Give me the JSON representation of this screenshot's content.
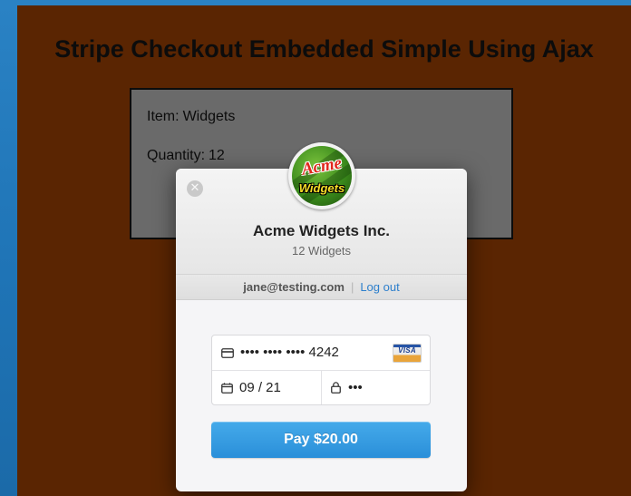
{
  "page": {
    "title": "Stripe Checkout Embedded Simple Using Ajax"
  },
  "order": {
    "item_label": "Item:",
    "item_value": "Widgets",
    "quantity_label": "Quantity:",
    "quantity_value": "12"
  },
  "checkout": {
    "close_glyph": "✕",
    "logo_text_top": "Acme",
    "logo_text_bottom": "Widgets",
    "merchant_name": "Acme Widgets Inc.",
    "description": "12 Widgets",
    "user_email": "jane@testing.com",
    "separator": "|",
    "logout_label": "Log out",
    "card_number": "•••• •••• •••• 4242",
    "card_brand": "VISA",
    "expiry": "09 / 21",
    "cvc": "•••",
    "pay_label": "Pay $20.00"
  },
  "icons": {
    "close": "close-icon",
    "card": "credit-card-icon",
    "calendar": "calendar-icon",
    "lock": "lock-icon",
    "brand": "visa-icon"
  },
  "colors": {
    "page_background": "#5a2502",
    "outer_background": "#2a82c4",
    "pay_button": "#2a8fd9",
    "link": "#2d7fcc"
  }
}
